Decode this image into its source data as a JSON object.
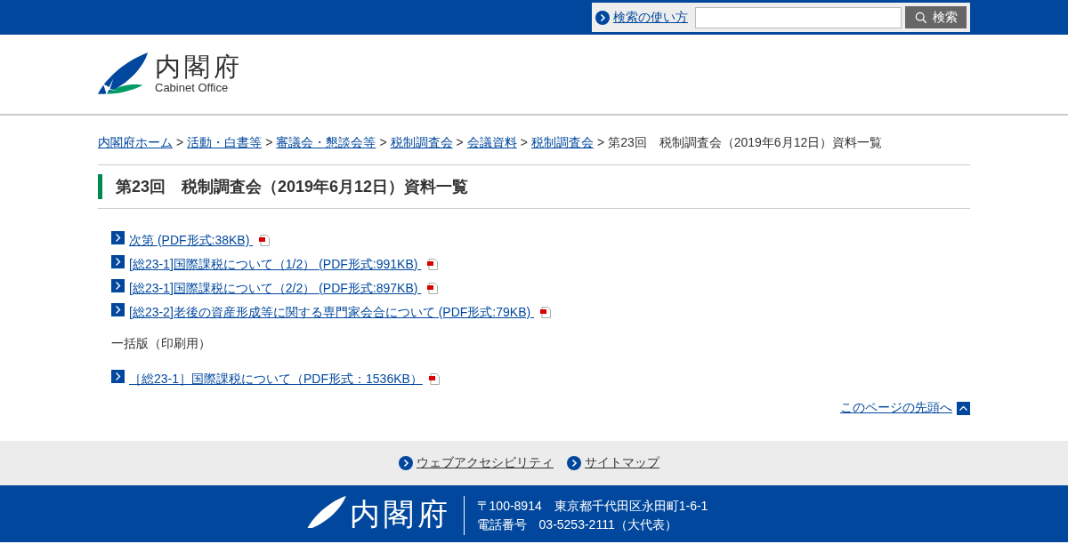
{
  "top_bar": {
    "help_link": "検索の使い方",
    "search_button": "検索"
  },
  "header": {
    "logo_title": "内閣府",
    "logo_subtitle": "Cabinet Office"
  },
  "breadcrumb": {
    "links": [
      "内閣府ホーム",
      "活動・白書等",
      "審議会・懇談会等",
      "税制調査会",
      "会議資料",
      "税制調査会"
    ],
    "separator": ">",
    "current": "第23回　税制調査会（2019年6月12日）資料一覧"
  },
  "page_title": "第23回　税制調査会（2019年6月12日）資料一覧",
  "documents": [
    {
      "label": "次第 (PDF形式:38KB) "
    },
    {
      "label": "[総23-1]国際課税について（1/2） (PDF形式:991KB) "
    },
    {
      "label": "[総23-1]国際課税について（2/2） (PDF形式:897KB) "
    },
    {
      "label": "[総23-2]老後の資産形成等に関する専門家会合について (PDF形式:79KB) "
    }
  ],
  "bulk_heading": "一括版（印刷用）",
  "bulk_documents": [
    {
      "label": "［総23-1］国際課税について（PDF形式：1536KB）"
    }
  ],
  "page_top_link": "このページの先頭へ",
  "footer_links": [
    "ウェブアクセシビリティ",
    "サイトマップ"
  ],
  "footer": {
    "logo_title": "内閣府",
    "address": "〒100-8914　東京都千代田区永田町1-6-1",
    "phone": "電話番号　03-5253-2111（大代表）"
  }
}
